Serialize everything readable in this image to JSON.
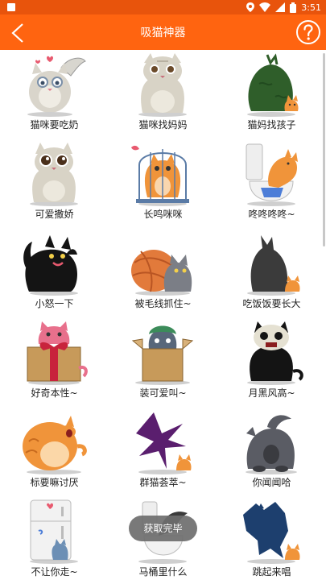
{
  "status_bar": {
    "time": "3:51"
  },
  "app_bar": {
    "title": "吸猫神器"
  },
  "items": [
    {
      "label": "猫咪要吃奶",
      "icon": "cat-winged-icon"
    },
    {
      "label": "猫咪找妈妈",
      "icon": "cat-sitting-icon"
    },
    {
      "label": "猫妈找孩子",
      "icon": "cat-bag-icon"
    },
    {
      "label": "可爱撒娇",
      "icon": "cat-cute-icon"
    },
    {
      "label": "长鸣咪咪",
      "icon": "cat-cage-icon"
    },
    {
      "label": "咚咚咚咚~",
      "icon": "cat-toilet-icon"
    },
    {
      "label": "小怒一下",
      "icon": "cat-angry-icon"
    },
    {
      "label": "被毛线抓住~",
      "icon": "cat-yarn-icon"
    },
    {
      "label": "吃饭饭要长大",
      "icon": "cat-shadow-icon"
    },
    {
      "label": "好奇本性~",
      "icon": "cat-gift-icon"
    },
    {
      "label": "装可爱叫~",
      "icon": "cat-box-icon"
    },
    {
      "label": "月黑风高~",
      "icon": "cat-ghost-icon"
    },
    {
      "label": "标要嘛讨厌",
      "icon": "cat-fat-icon"
    },
    {
      "label": "群猫荟萃~",
      "icon": "cat-bird-shadow-icon"
    },
    {
      "label": "你闻闻哈",
      "icon": "cat-butt-icon"
    },
    {
      "label": "不让你走~",
      "icon": "cat-fridge-icon"
    },
    {
      "label": "马桶里什么",
      "icon": "cat-toilet-tail-icon"
    },
    {
      "label": "跳起来唱",
      "icon": "cat-jump-shadow-icon"
    }
  ],
  "toast": {
    "text": "获取完毕"
  },
  "colors": {
    "status_bar": "#e8540c",
    "app_bar": "#ff6410"
  }
}
